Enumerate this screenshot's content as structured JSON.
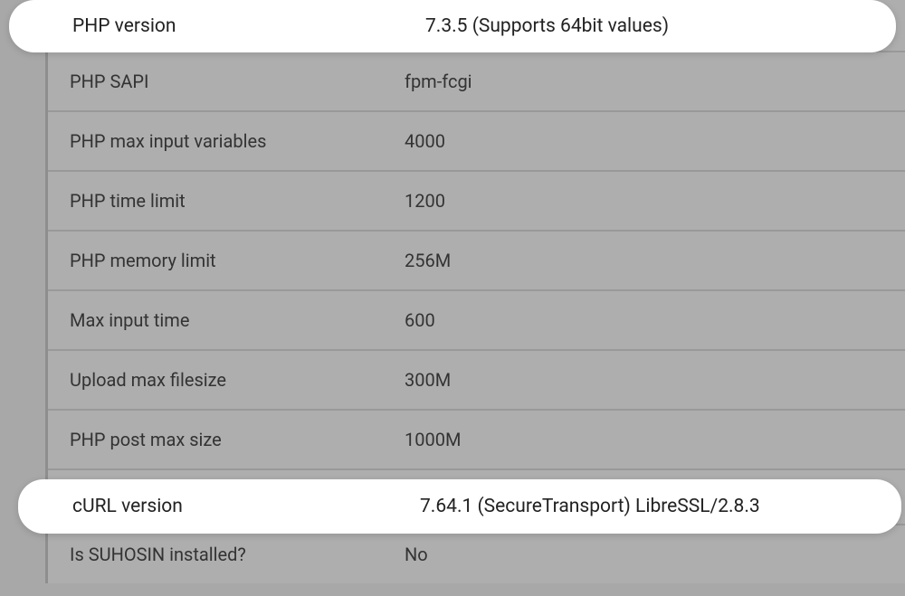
{
  "highlights": {
    "php_version": {
      "label": "PHP version",
      "value": "7.3.5 (Supports 64bit values)"
    },
    "curl_version": {
      "label": "cURL version",
      "value": "7.64.1 (SecureTransport) LibreSSL/2.8.3"
    }
  },
  "rows": [
    {
      "label": "PHP SAPI",
      "value": "fpm-fcgi"
    },
    {
      "label": "PHP max input variables",
      "value": "4000"
    },
    {
      "label": "PHP time limit",
      "value": "1200"
    },
    {
      "label": "PHP memory limit",
      "value": "256M"
    },
    {
      "label": "Max input time",
      "value": "600"
    },
    {
      "label": "Upload max filesize",
      "value": "300M"
    },
    {
      "label": "PHP post max size",
      "value": "1000M"
    }
  ],
  "last_row": {
    "label": "Is SUHOSIN installed?",
    "value": "No"
  }
}
